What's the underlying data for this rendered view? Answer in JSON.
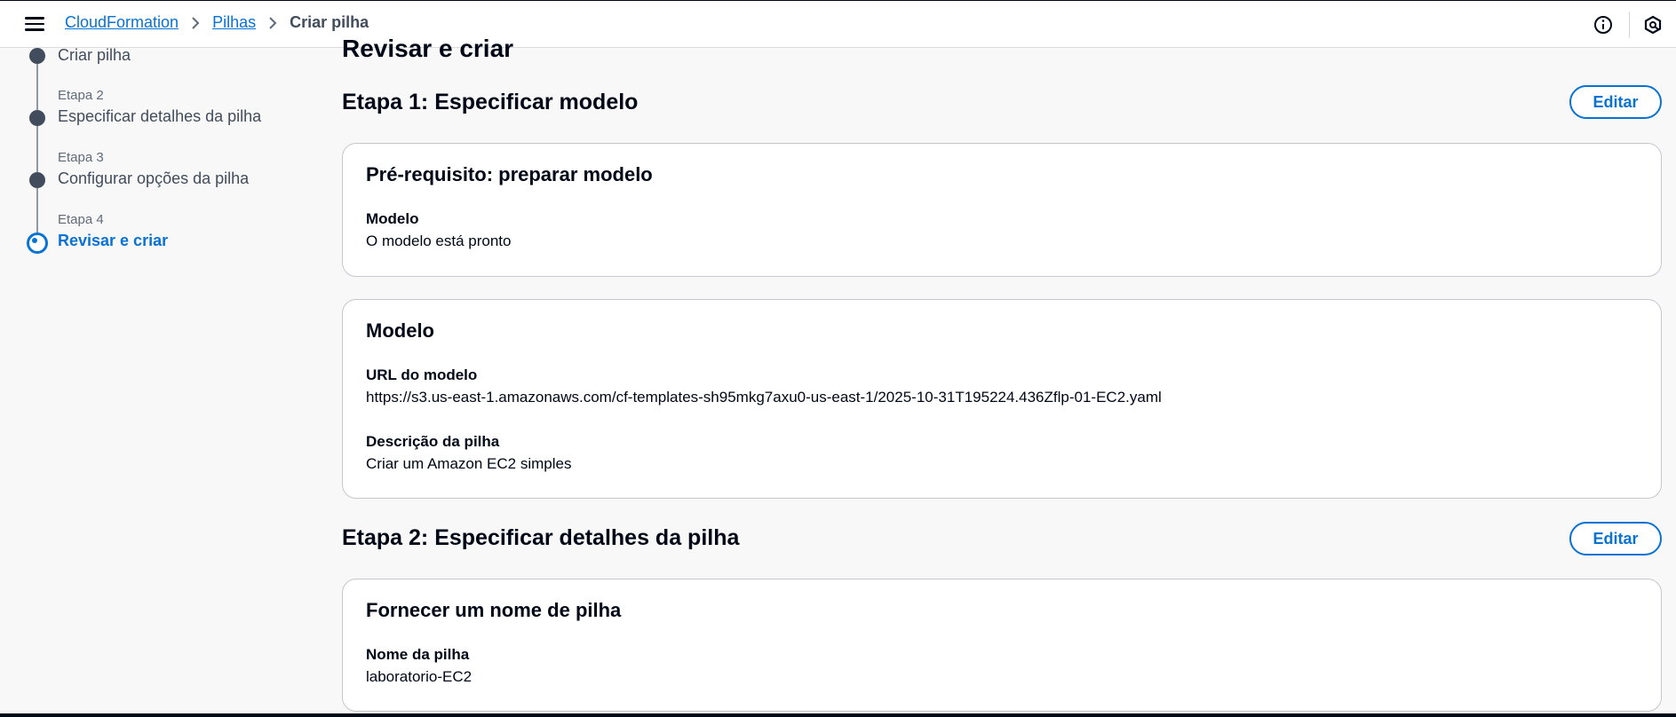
{
  "topbar": {
    "menu_icon": "hamburger-menu-icon",
    "breadcrumb": {
      "items": [
        "CloudFormation",
        "Pilhas"
      ],
      "current": "Criar pilha"
    },
    "info_icon": "info-icon",
    "settings_icon": "notifications-icon"
  },
  "steps": [
    {
      "number": "",
      "title": "Criar pilha",
      "active": false
    },
    {
      "number": "Etapa 2",
      "title": "Especificar detalhes da pilha",
      "active": false
    },
    {
      "number": "Etapa 3",
      "title": "Configurar opções da pilha",
      "active": false
    },
    {
      "number": "Etapa 4",
      "title": "Revisar e criar",
      "active": true
    }
  ],
  "main": {
    "page_title": "Revisar e criar",
    "section1": {
      "title": "Etapa 1: Especificar modelo",
      "edit_label": "Editar",
      "prereq_card": {
        "title": "Pré-requisito: preparar modelo",
        "label": "Modelo",
        "value": "O modelo está pronto"
      },
      "template_card": {
        "title": "Modelo",
        "url_label": "URL do modelo",
        "url_value": "https://s3.us-east-1.amazonaws.com/cf-templates-sh95mkg7axu0-us-east-1/2025-10-31T195224.436Zflp-01-EC2.yaml",
        "desc_label": "Descrição da pilha",
        "desc_value": "Criar um Amazon EC2 simples"
      }
    },
    "section2": {
      "title": "Etapa 2: Especificar detalhes da pilha",
      "edit_label": "Editar",
      "name_card": {
        "title": "Fornecer um nome de pilha",
        "label": "Nome da pilha",
        "value": "laboratorio-EC2"
      }
    }
  },
  "colors": {
    "accent": "#0972d3",
    "text": "#000716",
    "muted": "#5f6b7a",
    "background": "#f8f8f8"
  }
}
